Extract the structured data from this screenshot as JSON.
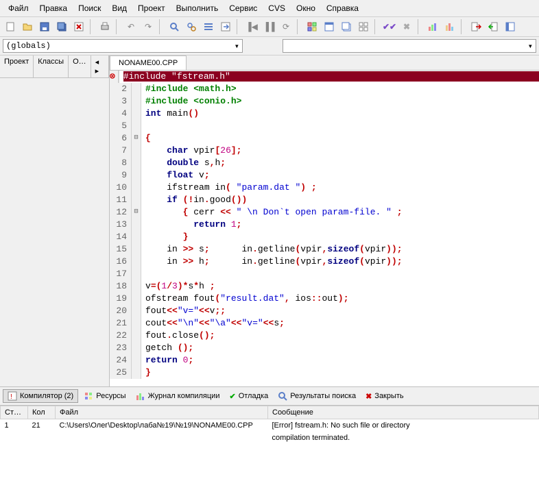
{
  "menu": {
    "items": [
      "Файл",
      "Правка",
      "Поиск",
      "Вид",
      "Проект",
      "Выполнить",
      "Сервис",
      "CVS",
      "Окно",
      "Справка"
    ]
  },
  "combos": {
    "globals": "(globals)"
  },
  "left_tabs": [
    "Проект",
    "Классы",
    "О…"
  ],
  "editor": {
    "tab": "NONAME00.CPP",
    "lines": [
      {
        "n": 1,
        "err": true,
        "fold": "",
        "html": "<span class='hl-err'>#include \"fstream.h\"                                                                 </span>"
      },
      {
        "n": 2,
        "err": false,
        "fold": "",
        "html": "<span class='tk-pre'>#include &lt;math.h&gt;</span>"
      },
      {
        "n": 3,
        "err": false,
        "fold": "",
        "html": "<span class='tk-pre'>#include &lt;conio.h&gt;</span>"
      },
      {
        "n": 4,
        "err": false,
        "fold": "",
        "html": "<span class='tk-kw'>int</span> main<span class='tk-op'>()</span>"
      },
      {
        "n": 5,
        "err": false,
        "fold": "",
        "html": ""
      },
      {
        "n": 6,
        "err": false,
        "fold": "⊟",
        "html": "<span class='tk-op'>{</span>"
      },
      {
        "n": 7,
        "err": false,
        "fold": "",
        "html": "    <span class='tk-kw'>char</span> vpir<span class='tk-op'>[</span><span class='tk-num'>26</span><span class='tk-op'>];</span>"
      },
      {
        "n": 8,
        "err": false,
        "fold": "",
        "html": "    <span class='tk-kw'>double</span> s<span class='tk-op'>,</span>h<span class='tk-op'>;</span>"
      },
      {
        "n": 9,
        "err": false,
        "fold": "",
        "html": "    <span class='tk-kw'>float</span> v<span class='tk-op'>;</span>"
      },
      {
        "n": 10,
        "err": false,
        "fold": "",
        "html": "    ifstream in<span class='tk-op'>(</span> <span class='tk-str'>\"param.dat \"</span><span class='tk-op'>)</span> <span class='tk-op'>;</span>"
      },
      {
        "n": 11,
        "err": false,
        "fold": "",
        "html": "    <span class='tk-kw'>if</span> <span class='tk-op'>(!</span>in<span class='tk-op'>.</span>good<span class='tk-op'>())</span>"
      },
      {
        "n": 12,
        "err": false,
        "fold": "⊟",
        "html": "       <span class='tk-op'>{</span> cerr <span class='tk-op'>&lt;&lt;</span> <span class='tk-str'>\" \\n Don`t open param-file. \"</span> <span class='tk-op'>;</span>"
      },
      {
        "n": 13,
        "err": false,
        "fold": "",
        "html": "         <span class='tk-kw'>return</span> <span class='tk-num'>1</span><span class='tk-op'>;</span>"
      },
      {
        "n": 14,
        "err": false,
        "fold": "",
        "html": "       <span class='tk-op'>}</span>"
      },
      {
        "n": 15,
        "err": false,
        "fold": "",
        "html": "    in <span class='tk-op'>&gt;&gt;</span> s<span class='tk-op'>;</span>      in<span class='tk-op'>.</span>getline<span class='tk-op'>(</span>vpir<span class='tk-op'>,</span><span class='tk-kw'>sizeof</span><span class='tk-op'>(</span>vpir<span class='tk-op'>));</span>"
      },
      {
        "n": 16,
        "err": false,
        "fold": "",
        "html": "    in <span class='tk-op'>&gt;&gt;</span> h<span class='tk-op'>;</span>      in<span class='tk-op'>.</span>getline<span class='tk-op'>(</span>vpir<span class='tk-op'>,</span><span class='tk-kw'>sizeof</span><span class='tk-op'>(</span>vpir<span class='tk-op'>));</span>"
      },
      {
        "n": 17,
        "err": false,
        "fold": "",
        "html": ""
      },
      {
        "n": 18,
        "err": false,
        "fold": "",
        "html": "v<span class='tk-op'>=(</span><span class='tk-num'>1</span><span class='tk-op'>/</span><span class='tk-num'>3</span><span class='tk-op'>)*</span>s<span class='tk-op'>*</span>h <span class='tk-op'>;</span>"
      },
      {
        "n": 19,
        "err": false,
        "fold": "",
        "html": "ofstream fout<span class='tk-op'>(</span><span class='tk-str'>\"result.dat\"</span><span class='tk-op'>,</span> ios<span class='tk-op'>::</span>out<span class='tk-op'>);</span>"
      },
      {
        "n": 20,
        "err": false,
        "fold": "",
        "html": "fout<span class='tk-op'>&lt;&lt;</span><span class='tk-str'>\"v=\"</span><span class='tk-op'>&lt;&lt;</span>v<span class='tk-op'>;;</span>"
      },
      {
        "n": 21,
        "err": false,
        "fold": "",
        "html": "cout<span class='tk-op'>&lt;&lt;</span><span class='tk-str'>\"\\n\"</span><span class='tk-op'>&lt;&lt;</span><span class='tk-str'>\"\\a\"</span><span class='tk-op'>&lt;&lt;</span><span class='tk-str'>\"v=\"</span><span class='tk-op'>&lt;&lt;</span>s<span class='tk-op'>;</span>"
      },
      {
        "n": 22,
        "err": false,
        "fold": "",
        "html": "fout<span class='tk-op'>.</span>close<span class='tk-op'>();</span>"
      },
      {
        "n": 23,
        "err": false,
        "fold": "",
        "html": "getch <span class='tk-op'>();</span>"
      },
      {
        "n": 24,
        "err": false,
        "fold": "",
        "html": "<span class='tk-kw'>return</span> <span class='tk-num'>0</span><span class='tk-op'>;</span>"
      },
      {
        "n": 25,
        "err": false,
        "fold": "",
        "html": "<span class='tk-op'>}</span>"
      }
    ]
  },
  "bottom_tabs": {
    "compiler": "Компилятор (2)",
    "resources": "Ресурсы",
    "compile_log": "Журнал компиляции",
    "debug": "Отладка",
    "search": "Результаты поиска",
    "close": "Закрыть"
  },
  "err_table": {
    "headers": [
      "Ст…",
      "Кол",
      "Файл",
      "Сообщение"
    ],
    "rows": [
      {
        "line": "1",
        "col": "21",
        "file": "C:\\Users\\Олег\\Desktop\\лаба№19\\№19\\NONAME00.CPP",
        "msg": "[Error] fstream.h: No such file or directory"
      },
      {
        "line": "",
        "col": "",
        "file": "",
        "msg": "compilation terminated."
      }
    ]
  }
}
